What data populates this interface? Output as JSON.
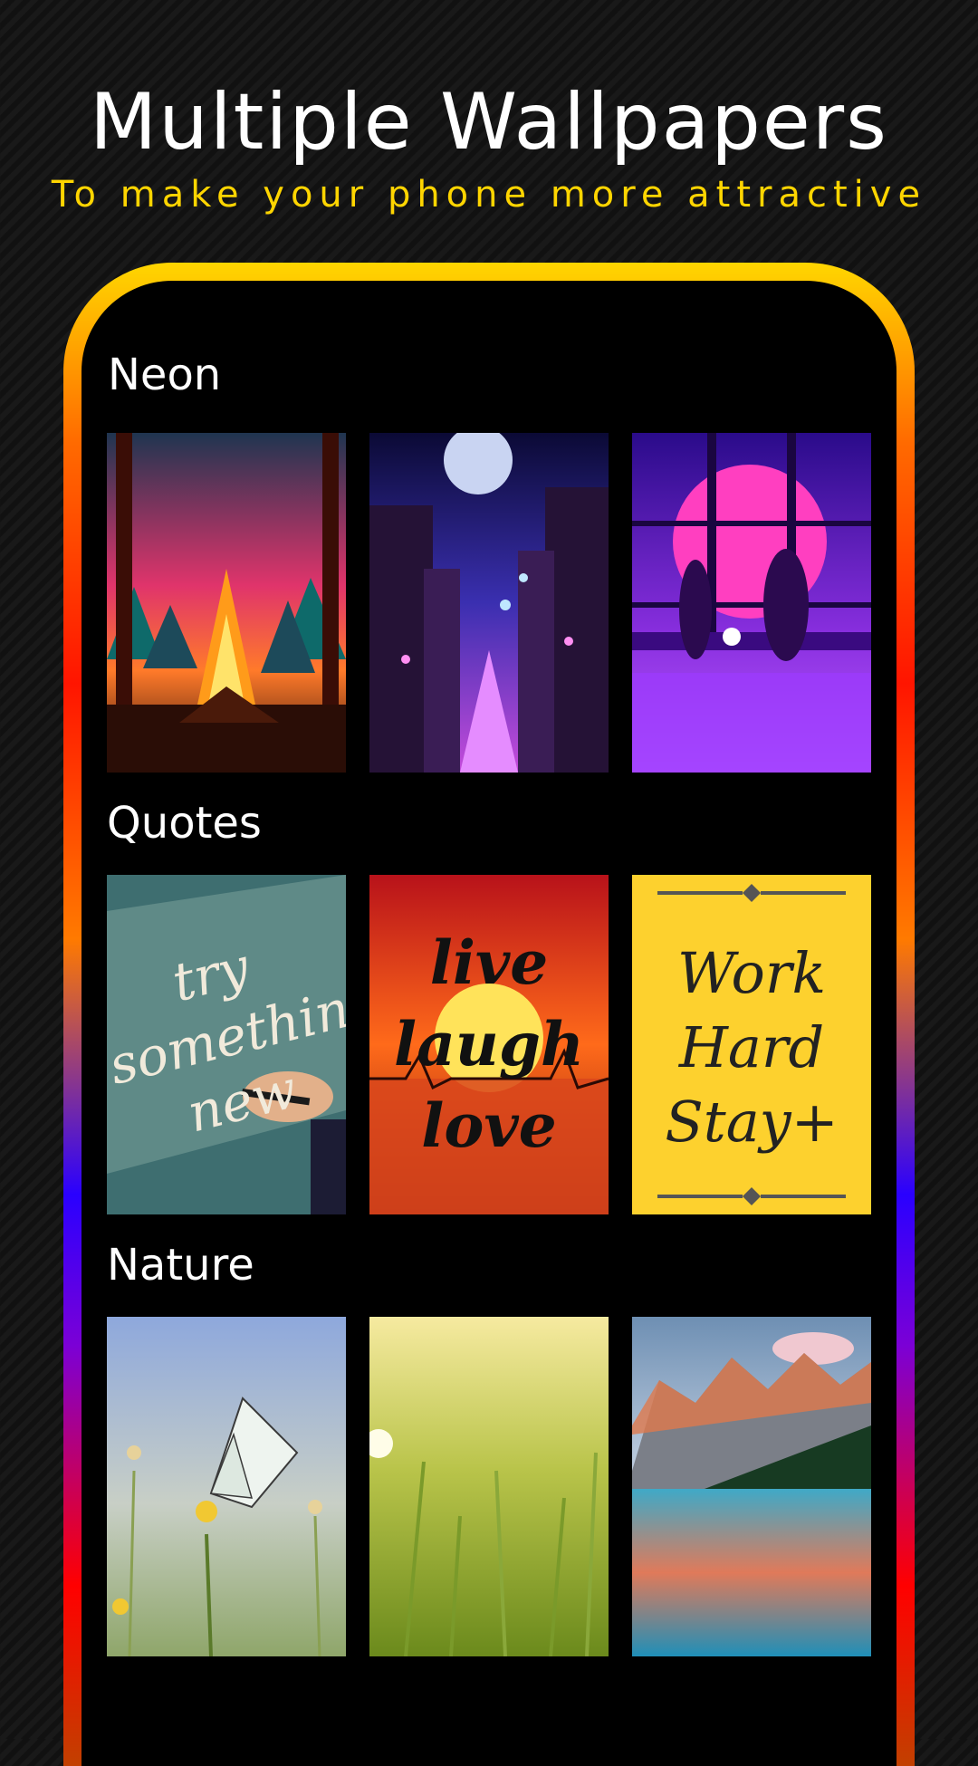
{
  "header": {
    "title": "Multiple Wallpapers",
    "subtitle": "To make your phone more attractive"
  },
  "sections": [
    {
      "label": "Neon",
      "items": [
        {
          "name": "neon-campfire-forest"
        },
        {
          "name": "neon-city-street"
        },
        {
          "name": "neon-couple-window"
        }
      ]
    },
    {
      "label": "Quotes",
      "items": [
        {
          "name": "quote-try-something-new",
          "lines": [
            "try",
            "something",
            "new"
          ]
        },
        {
          "name": "quote-live-laugh-love",
          "lines": [
            "live",
            "laugh",
            "love"
          ]
        },
        {
          "name": "quote-work-hard-stay",
          "lines": [
            "Work",
            "Hard",
            "Stay+"
          ]
        }
      ]
    },
    {
      "label": "Nature",
      "items": [
        {
          "name": "nature-butterfly"
        },
        {
          "name": "nature-wheat-field"
        },
        {
          "name": "nature-mountain-lake"
        }
      ]
    }
  ],
  "colors": {
    "accent_yellow": "#ffd500",
    "frame_red": "#ff1500",
    "frame_blue": "#2a00ff"
  }
}
